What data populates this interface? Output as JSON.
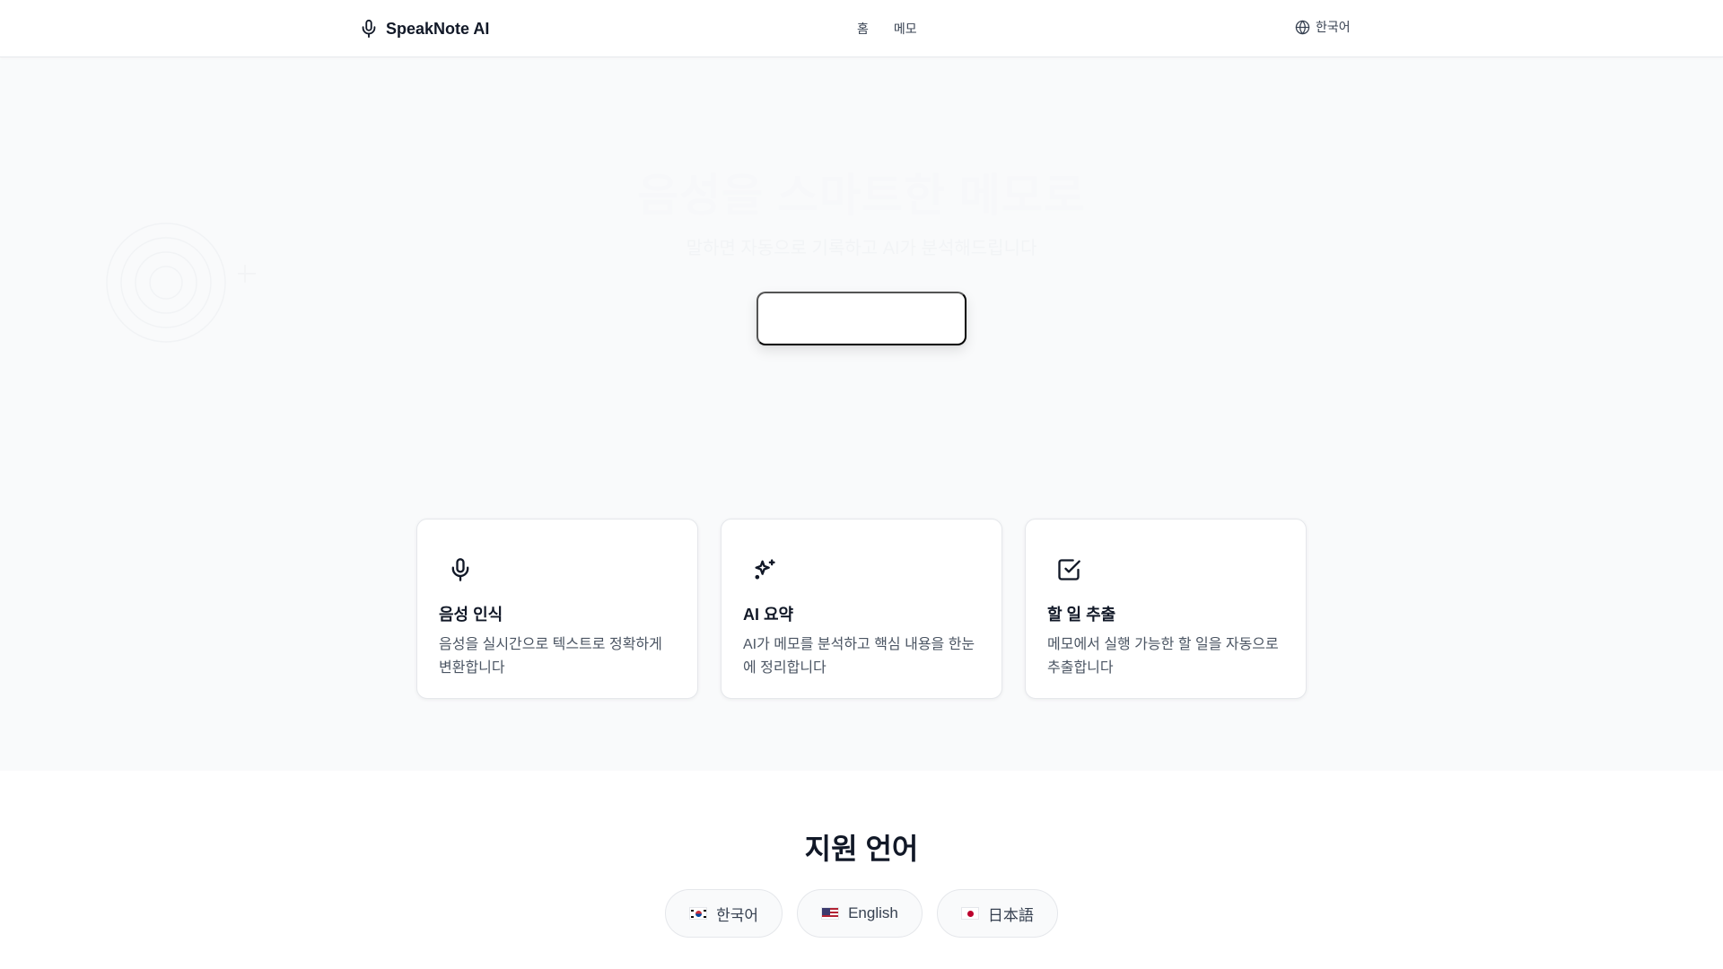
{
  "header": {
    "brand": "SpeakNote AI",
    "nav": [
      {
        "label": "홈"
      },
      {
        "label": "메모"
      }
    ],
    "language": "한국어"
  },
  "hero": {
    "title": "음성을 스마트한 메모로",
    "subtitle": "말하면 자동으로 기록하고 AI가 분석해드립니다",
    "cta_label": ""
  },
  "features": [
    {
      "icon": "microphone-icon",
      "title": "음성 인식",
      "description": "음성을 실시간으로 텍스트로 정확하게 변환합니다"
    },
    {
      "icon": "sparkles-icon",
      "title": "AI 요약",
      "description": "AI가 메모를 분석하고 핵심 내용을 한눈에 정리합니다"
    },
    {
      "icon": "check-square-icon",
      "title": "할 일 추출",
      "description": "메모에서 실행 가능한 할 일을 자동으로 추출합니다"
    }
  ],
  "languages": {
    "title": "지원 언어",
    "items": [
      {
        "flag": "kr-flag-icon",
        "label": "한국어"
      },
      {
        "flag": "us-flag-icon",
        "label": "English"
      },
      {
        "flag": "jp-flag-icon",
        "label": "日本語"
      }
    ]
  },
  "colors": {
    "text_primary": "#111827",
    "text_secondary": "#4b5563",
    "hero_background": "#f9fafb",
    "border": "#e5e7eb"
  }
}
